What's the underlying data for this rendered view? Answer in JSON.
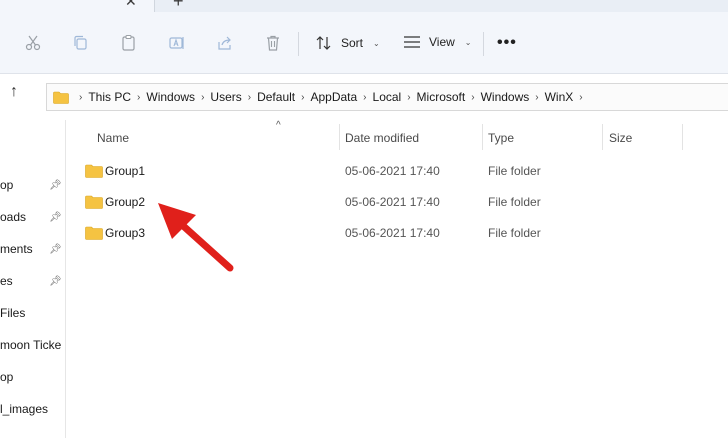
{
  "toolbar": {
    "sort_label": "Sort",
    "view_label": "View"
  },
  "address": {
    "crumbs": [
      "This PC",
      "Windows",
      "Users",
      "Default",
      "AppData",
      "Local",
      "Microsoft",
      "Windows",
      "WinX"
    ]
  },
  "nav": {
    "items": [
      {
        "label": "op",
        "pinned": true
      },
      {
        "label": "oads",
        "pinned": true
      },
      {
        "label": "ments",
        "pinned": true
      },
      {
        "label": "es",
        "pinned": true
      },
      {
        "label": "Files",
        "pinned": false
      },
      {
        "label": "moon Ticke",
        "pinned": false
      },
      {
        "label": "op",
        "pinned": false
      },
      {
        "label": "l_images",
        "pinned": false
      }
    ]
  },
  "columns": {
    "name": "Name",
    "date_modified": "Date modified",
    "type": "Type",
    "size": "Size"
  },
  "files": [
    {
      "name": "Group1",
      "date_modified": "05-06-2021 17:40",
      "type": "File folder"
    },
    {
      "name": "Group2",
      "date_modified": "05-06-2021 17:40",
      "type": "File folder"
    },
    {
      "name": "Group3",
      "date_modified": "05-06-2021 17:40",
      "type": "File folder"
    }
  ],
  "colors": {
    "folder": "#f5c342",
    "annotation_arrow": "#e0201b",
    "command_bar_bg": "#f3f6fb"
  },
  "icons": [
    "cut-icon",
    "copy-icon",
    "paste-icon",
    "rename-icon",
    "share-icon",
    "delete-icon",
    "sort-icon",
    "view-icon",
    "more-icon",
    "up-arrow-icon",
    "folder-icon",
    "pin-icon"
  ]
}
